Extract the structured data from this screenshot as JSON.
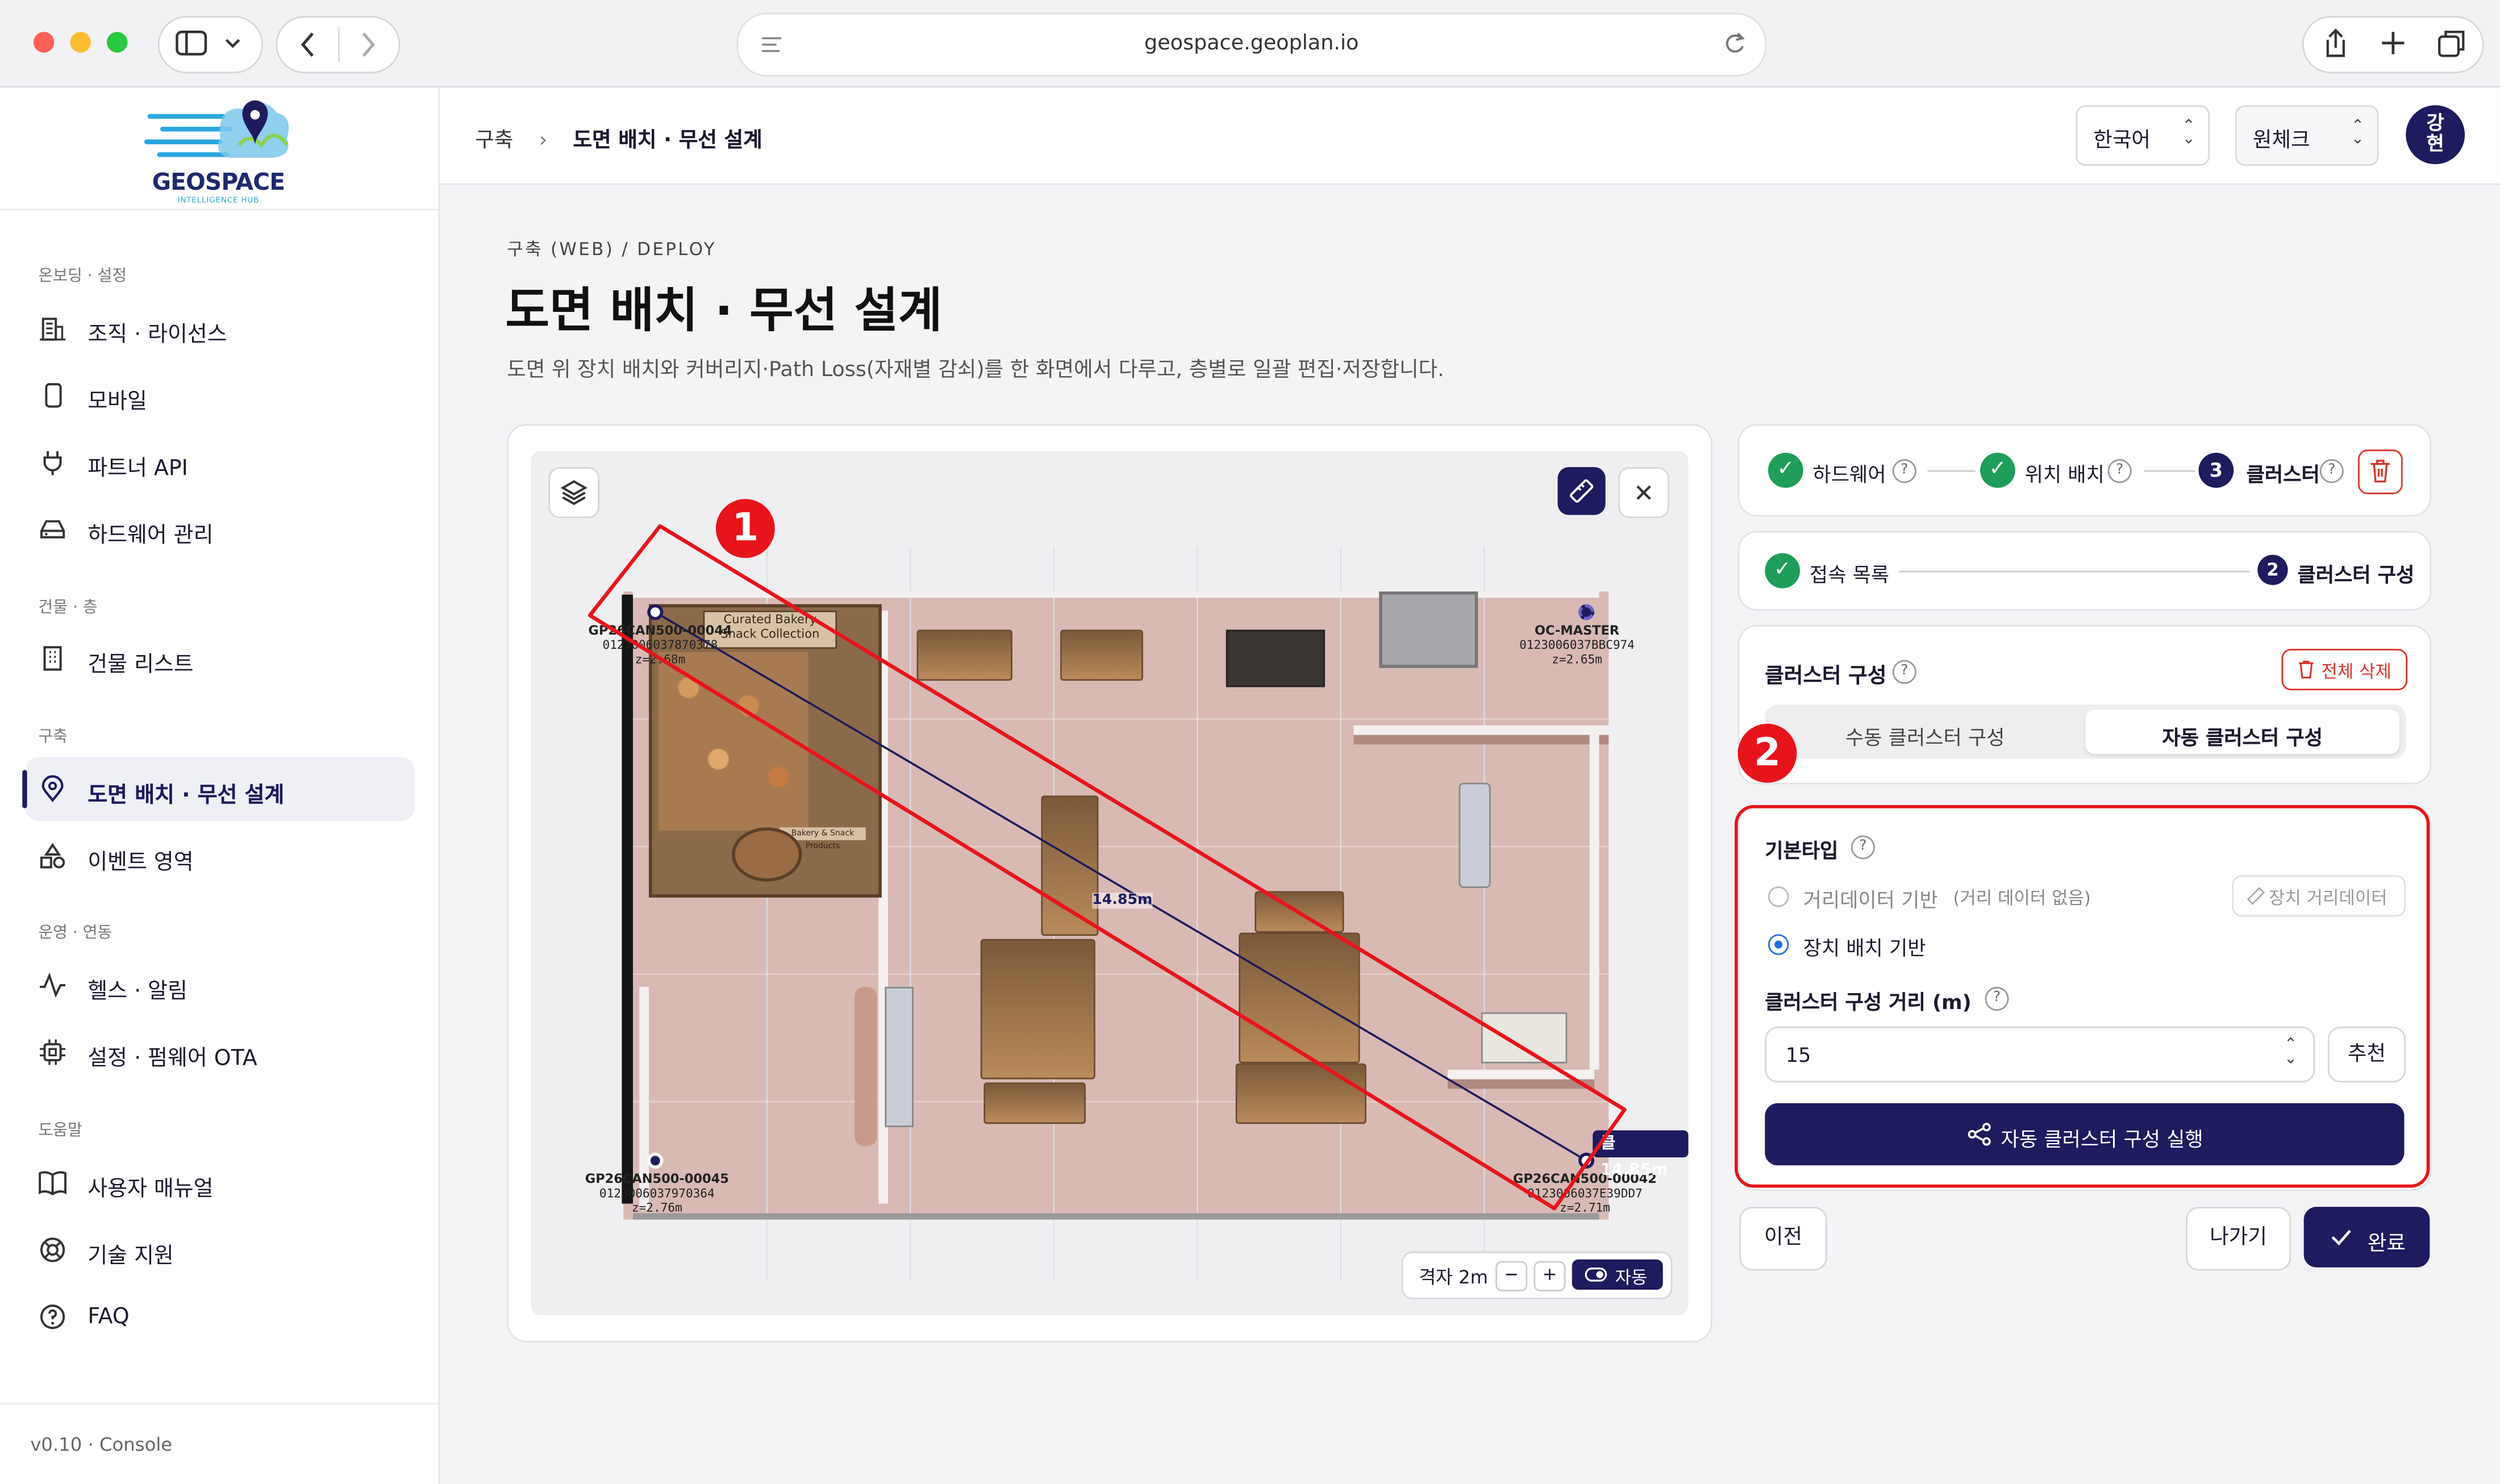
{
  "browser": {
    "url": "geospace.geoplan.io"
  },
  "logo": {
    "name": "GEOSPACE",
    "tagline": "INTELLIGENCE HUB"
  },
  "sidebar": {
    "sections": [
      {
        "title": "온보딩 · 설정",
        "items": [
          "조직 · 라이선스",
          "모바일",
          "파트너 API",
          "하드웨어 관리"
        ]
      },
      {
        "title": "건물 · 층",
        "items": [
          "건물 리스트"
        ]
      },
      {
        "title": "구축",
        "items": [
          "도면 배치 · 무선 설계",
          "이벤트 영역"
        ]
      },
      {
        "title": "운영 · 연동",
        "items": [
          "헬스 · 알림",
          "설정 · 펌웨어 OTA"
        ]
      },
      {
        "title": "도움말",
        "items": [
          "사용자 매뉴얼",
          "기술 지원",
          "FAQ"
        ]
      }
    ],
    "version": "v0.10 · Console"
  },
  "header": {
    "breadcrumb": [
      "구축",
      "도면 배치 · 무선 설계"
    ],
    "language": "한국어",
    "workspace": "원체크",
    "avatar": "강\n현"
  },
  "page": {
    "overline": "구축 (WEB) / DEPLOY",
    "title": "도면 배치 · 무선 설계",
    "description": "도면 위 장치 배치와 커버리지·Path Loss(자재별 감쇠)를 한 화면에서 다루고, 층별로 일괄 편집·저장합니다."
  },
  "map": {
    "devices": [
      {
        "name": "GP26CAN500-00044",
        "id": "0123006037870378",
        "z": "z=2.68m"
      },
      {
        "name": "OC-MASTER",
        "id": "0123006037BBC974",
        "z": "z=2.65m"
      },
      {
        "name": "GP26CAN500-00045",
        "id": "0123006037970364",
        "z": "z=2.76m"
      },
      {
        "name": "GP26CAN500-00042",
        "id": "0123006037E39DD7",
        "z": "z=2.71m"
      }
    ],
    "distance_label": "14.85m",
    "tag_label": "클 14.85m",
    "grid_label": "격자 2m",
    "grid_minus": "−",
    "grid_plus": "+",
    "auto_label": "자동",
    "shelf_signs": [
      "Curated Bakery",
      "Snack Collection",
      "Bakery & Snack Products"
    ]
  },
  "steps": {
    "items": [
      {
        "label": "하드웨어",
        "state": "done"
      },
      {
        "label": "위치 배치",
        "state": "done"
      },
      {
        "num": "3",
        "label": "클러스터",
        "state": "current"
      }
    ],
    "sub": [
      {
        "label": "접속 목록",
        "state": "done"
      },
      {
        "num": "2",
        "label": "클러스터 구성",
        "state": "current"
      }
    ]
  },
  "cluster": {
    "title": "클러스터 구성",
    "delete_all": "전체 삭제",
    "tabs": [
      "수동 클러스터 구성",
      "자동 클러스터 구성"
    ],
    "base_type_label": "기본타입",
    "option1": "거리데이터 기반",
    "option1_note": "(거리 데이터 없음)",
    "option1_btn": "장치 거리데이터",
    "option2": "장치 배치 기반",
    "distance_label": "클러스터 구성 거리 (m)",
    "distance_value": "15",
    "recommend": "추천",
    "run": "자동 클러스터 구성 실행"
  },
  "footer": {
    "prev": "이전",
    "exit": "나가기",
    "done": "완료"
  },
  "annotations": [
    "1",
    "2"
  ],
  "colors": {
    "primary": "#1e1b5e",
    "success": "#1e9e58",
    "annotation": "#e8141c",
    "danger": "#d9342b"
  }
}
